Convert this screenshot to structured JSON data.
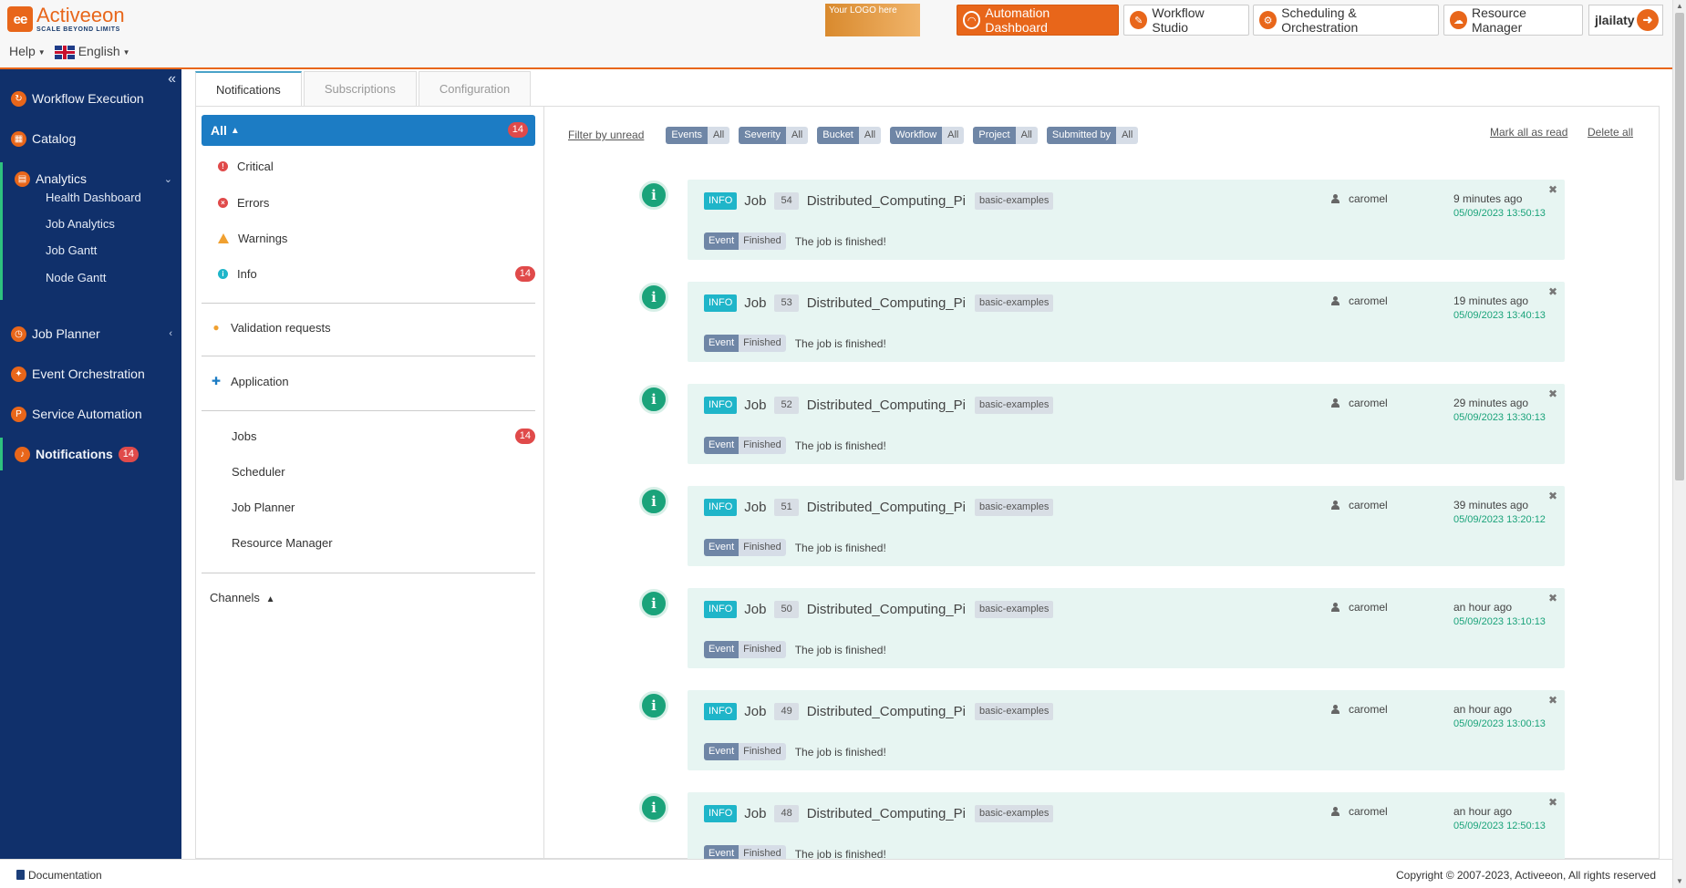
{
  "brand": {
    "mark": "ee",
    "name": "Activeeon",
    "tagline": "SCALE BEYOND LIMITS"
  },
  "header": {
    "help_label": "Help",
    "language_label": "English",
    "logo_placeholder": "Your LOGO here",
    "apps": [
      {
        "label": "Automation Dashboard",
        "active": true
      },
      {
        "label": "Workflow Studio",
        "active": false
      },
      {
        "label": "Scheduling & Orchestration",
        "active": false
      },
      {
        "label": "Resource Manager",
        "active": false
      }
    ],
    "user_name": "jlailaty"
  },
  "sidebar": {
    "items": [
      {
        "label": "Workflow Execution"
      },
      {
        "label": "Catalog"
      },
      {
        "label": "Analytics"
      },
      {
        "label": "Job Planner"
      },
      {
        "label": "Event Orchestration"
      },
      {
        "label": "Service Automation"
      },
      {
        "label": "Notifications",
        "badge": "14"
      }
    ],
    "analytics_sub": [
      "Health Dashboard",
      "Job Analytics",
      "Job Gantt",
      "Node Gantt"
    ]
  },
  "tabs": [
    "Notifications",
    "Subscriptions",
    "Configuration"
  ],
  "filters": {
    "all_label": "All",
    "all_count": "14",
    "severities": [
      {
        "label": "Critical",
        "color": "#e04a4a"
      },
      {
        "label": "Errors",
        "color": "#e04a4a"
      },
      {
        "label": "Warnings",
        "color": "#f0a030"
      },
      {
        "label": "Info",
        "color": "#1fb5c9",
        "count": "14"
      }
    ],
    "validation_label": "Validation requests",
    "application_label": "Application",
    "app_sources": [
      {
        "label": "Jobs",
        "count": "14"
      },
      {
        "label": "Scheduler"
      },
      {
        "label": "Job Planner"
      },
      {
        "label": "Resource Manager"
      }
    ],
    "channels_label": "Channels"
  },
  "toolbar": {
    "filter_unread": "Filter by unread",
    "chips": [
      {
        "label": "Events",
        "value": "All"
      },
      {
        "label": "Severity",
        "value": "All"
      },
      {
        "label": "Bucket",
        "value": "All"
      },
      {
        "label": "Workflow",
        "value": "All"
      },
      {
        "label": "Project",
        "value": "All"
      },
      {
        "label": "Submitted by",
        "value": "All"
      }
    ],
    "mark_all_read": "Mark all as read",
    "delete_all": "Delete all"
  },
  "notifications": [
    {
      "level": "INFO",
      "job_word": "Job",
      "job_id": "54",
      "workflow": "Distributed_Computing_Pi",
      "bucket": "basic-examples",
      "event": "Event",
      "status": "Finished",
      "message": "The job is finished!",
      "user": "caromel",
      "time_ago": "9 minutes ago",
      "date": "05/09/2023 13:50:13"
    },
    {
      "level": "INFO",
      "job_word": "Job",
      "job_id": "53",
      "workflow": "Distributed_Computing_Pi",
      "bucket": "basic-examples",
      "event": "Event",
      "status": "Finished",
      "message": "The job is finished!",
      "user": "caromel",
      "time_ago": "19 minutes ago",
      "date": "05/09/2023 13:40:13"
    },
    {
      "level": "INFO",
      "job_word": "Job",
      "job_id": "52",
      "workflow": "Distributed_Computing_Pi",
      "bucket": "basic-examples",
      "event": "Event",
      "status": "Finished",
      "message": "The job is finished!",
      "user": "caromel",
      "time_ago": "29 minutes ago",
      "date": "05/09/2023 13:30:13"
    },
    {
      "level": "INFO",
      "job_word": "Job",
      "job_id": "51",
      "workflow": "Distributed_Computing_Pi",
      "bucket": "basic-examples",
      "event": "Event",
      "status": "Finished",
      "message": "The job is finished!",
      "user": "caromel",
      "time_ago": "39 minutes ago",
      "date": "05/09/2023 13:20:12"
    },
    {
      "level": "INFO",
      "job_word": "Job",
      "job_id": "50",
      "workflow": "Distributed_Computing_Pi",
      "bucket": "basic-examples",
      "event": "Event",
      "status": "Finished",
      "message": "The job is finished!",
      "user": "caromel",
      "time_ago": "an hour ago",
      "date": "05/09/2023 13:10:13"
    },
    {
      "level": "INFO",
      "job_word": "Job",
      "job_id": "49",
      "workflow": "Distributed_Computing_Pi",
      "bucket": "basic-examples",
      "event": "Event",
      "status": "Finished",
      "message": "The job is finished!",
      "user": "caromel",
      "time_ago": "an hour ago",
      "date": "05/09/2023 13:00:13"
    },
    {
      "level": "INFO",
      "job_word": "Job",
      "job_id": "48",
      "workflow": "Distributed_Computing_Pi",
      "bucket": "basic-examples",
      "event": "Event",
      "status": "Finished",
      "message": "The job is finished!",
      "user": "caromel",
      "time_ago": "an hour ago",
      "date": "05/09/2023 12:50:13"
    }
  ],
  "footer": {
    "documentation": "Documentation",
    "copyright": "Copyright © 2007-2023, Activeeon, All rights reserved"
  },
  "colors": {
    "accent": "#e8661a",
    "sidebar": "#10306b",
    "primary": "#1c7cc4",
    "info": "#1fb5c9",
    "success": "#1aa37a"
  }
}
